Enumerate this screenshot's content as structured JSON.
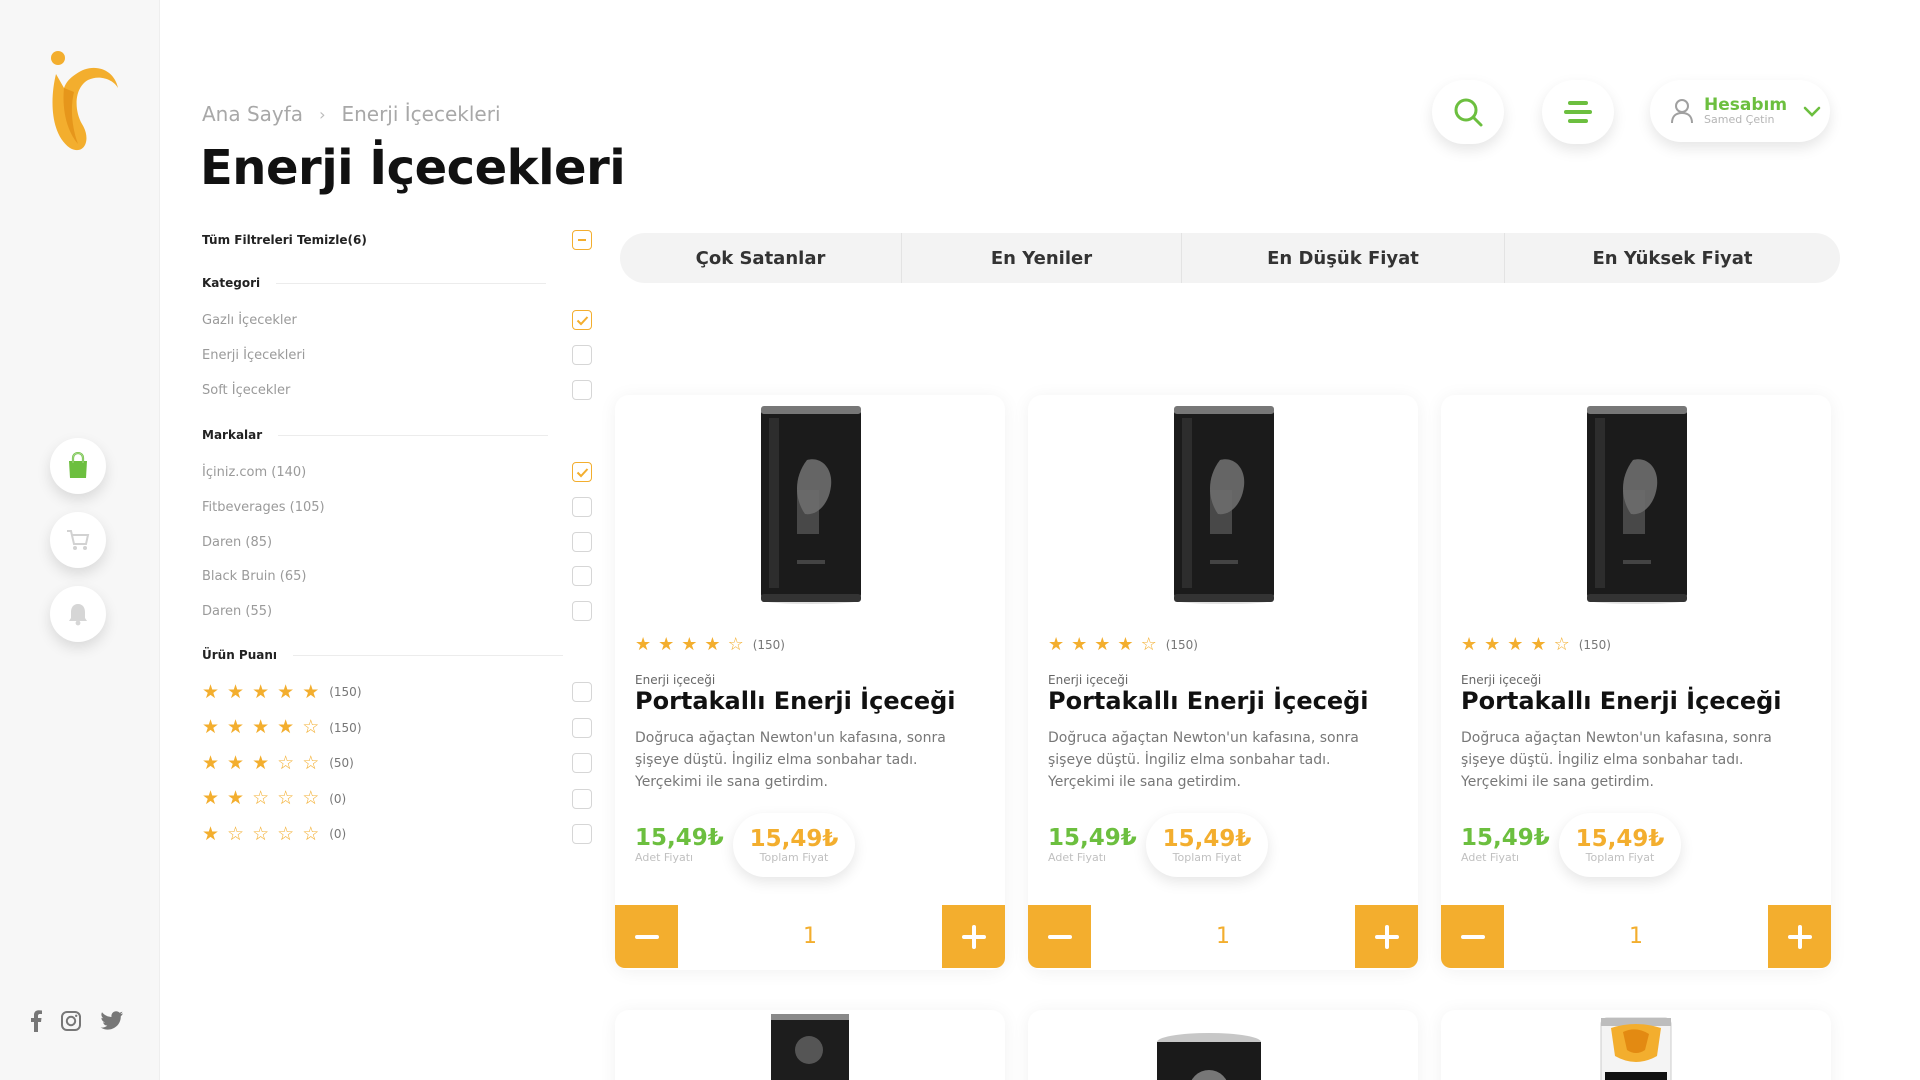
{
  "breadcrumb": {
    "home": "Ana Sayfa",
    "separator": "›",
    "current": "Enerji İçecekleri"
  },
  "page_title": "Enerji İçecekleri",
  "account": {
    "label": "Hesabım",
    "user": "Samed Çetin"
  },
  "filters": {
    "clear_all": "Tüm Filtreleri Temizle(6)",
    "category_title": "Kategori",
    "categories": [
      {
        "label": "Gazlı İçecekler",
        "checked": true
      },
      {
        "label": "Enerji İçecekleri",
        "checked": false
      },
      {
        "label": "Soft İçecekler",
        "checked": false
      }
    ],
    "brands_title": "Markalar",
    "brands": [
      {
        "label": "İçiniz.com (140)",
        "checked": true
      },
      {
        "label": "Fitbeverages (105)",
        "checked": false
      },
      {
        "label": "Daren (85)",
        "checked": false
      },
      {
        "label": "Black Bruin (65)",
        "checked": false
      },
      {
        "label": "Daren (55)",
        "checked": false
      }
    ],
    "rating_title": "Ürün Puanı",
    "ratings": [
      {
        "stars": 5,
        "count": "(150)"
      },
      {
        "stars": 4,
        "count": "(150)"
      },
      {
        "stars": 3,
        "count": "(50)"
      },
      {
        "stars": 2,
        "count": "(0)"
      },
      {
        "stars": 1,
        "count": "(0)"
      }
    ]
  },
  "sort_tabs": [
    "Çok Satanlar",
    "En Yeniler",
    "En Düşük Fiyat",
    "En Yüksek Fiyat"
  ],
  "products": [
    {
      "stars": 4,
      "reviews": "(150)",
      "category": "Enerji içeceği",
      "name": "Portakallı Enerji İçeceği",
      "description": "Doğruca ağaçtan Newton'un kafasına, sonra şişeye düştü. İngiliz elma sonbahar tadı. Yerçekimi ile sana getirdim.",
      "unit_price": "15,49₺",
      "unit_label": "Adet Fiyatı",
      "total_price": "15,49₺",
      "total_label": "Toplam Fiyat",
      "qty": "1"
    },
    {
      "stars": 4,
      "reviews": "(150)",
      "category": "Enerji içeceği",
      "name": "Portakallı Enerji İçeceği",
      "description": "Doğruca ağaçtan Newton'un kafasına, sonra şişeye düştü. İngiliz elma sonbahar tadı. Yerçekimi ile sana getirdim.",
      "unit_price": "15,49₺",
      "unit_label": "Adet Fiyatı",
      "total_price": "15,49₺",
      "total_label": "Toplam Fiyat",
      "qty": "1"
    },
    {
      "stars": 4,
      "reviews": "(150)",
      "category": "Enerji içeceği",
      "name": "Portakallı Enerji İçeceği",
      "description": "Doğruca ağaçtan Newton'un kafasına, sonra şişeye düştü. İngiliz elma sonbahar tadı. Yerçekimi ile sana getirdim.",
      "unit_price": "15,49₺",
      "unit_label": "Adet Fiyatı",
      "total_price": "15,49₺",
      "total_label": "Toplam Fiyat",
      "qty": "1"
    }
  ],
  "colors": {
    "accent": "#f3ae2e",
    "green": "#6cbf3f"
  },
  "icons": {
    "rail": [
      "shopping-bag-icon",
      "cart-icon",
      "bell-icon"
    ],
    "social": [
      "facebook-icon",
      "instagram-icon",
      "twitter-icon"
    ],
    "header": [
      "search-icon",
      "menu-icon",
      "user-icon",
      "chevron-down-icon"
    ]
  }
}
